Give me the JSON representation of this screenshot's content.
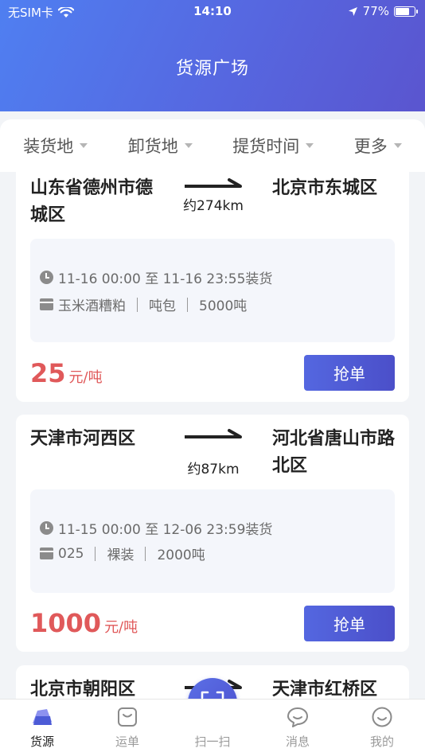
{
  "status_bar": {
    "carrier": "无SIM卡",
    "time": "14:10",
    "battery": "77%",
    "battery_level": 0.77
  },
  "header": {
    "title": "货源广场"
  },
  "filters": [
    {
      "label": "装货地"
    },
    {
      "label": "卸货地"
    },
    {
      "label": "提货时间"
    },
    {
      "label": "更多"
    }
  ],
  "cards": [
    {
      "from": "山东省德州市德城区",
      "to": "北京市东城区",
      "distance": "约274km",
      "time_range": "11-16 00:00 至 11-16 23:55装货",
      "goods_name": "玉米酒糟粕",
      "packaging": "吨包",
      "weight": "5000吨",
      "price": "25",
      "price_unit": "元/吨",
      "button_label": "抢单"
    },
    {
      "from": "天津市河西区",
      "to": "河北省唐山市路北区",
      "distance": "约87km",
      "time_range": "11-15 00:00 至 12-06 23:59装货",
      "goods_name": "025",
      "packaging": "裸装",
      "weight": "2000吨",
      "price": "1000",
      "price_unit": "元/吨",
      "button_label": "抢单"
    },
    {
      "from": "北京市朝阳区",
      "to": "天津市红桥区"
    }
  ],
  "tabbar": {
    "items": [
      {
        "label": "货源",
        "icon": "cargo-icon",
        "active": true
      },
      {
        "label": "运单",
        "icon": "waybill-icon",
        "active": false
      },
      {
        "label": "扫一扫",
        "icon": "scan-icon",
        "active": false
      },
      {
        "label": "消息",
        "icon": "message-icon",
        "active": false
      },
      {
        "label": "我的",
        "icon": "profile-icon",
        "active": false
      }
    ]
  },
  "colors": {
    "accent": "#5466de",
    "price": "#e0595a"
  }
}
